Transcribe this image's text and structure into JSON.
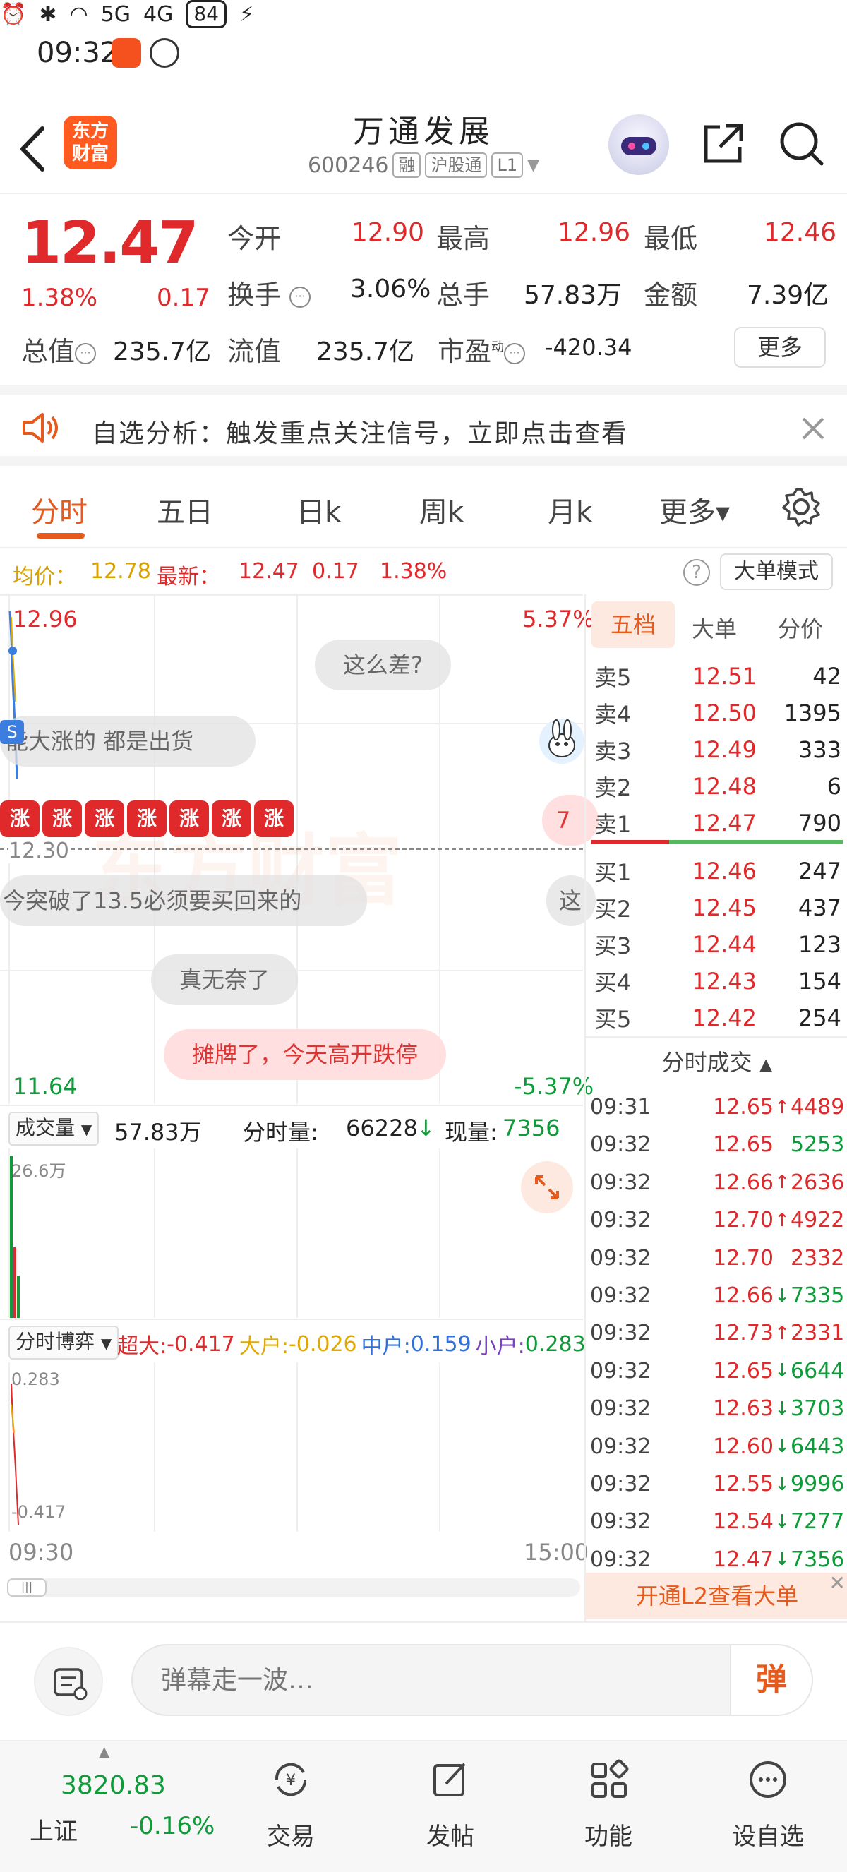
{
  "status": {
    "time": "09:32",
    "network_5g": "5G",
    "network_4g": "4G",
    "battery": "84"
  },
  "header": {
    "back_label": "",
    "logo_text_line1": "东方",
    "logo_text_line2": "财富",
    "stock_name": "万通发展",
    "stock_code": "600246",
    "tags": [
      "融",
      "沪股通",
      "L1"
    ]
  },
  "quote": {
    "price": "12.47",
    "change_pct": "1.38%",
    "change": "0.17",
    "open_label": "今开",
    "open": "12.90",
    "high_label": "最高",
    "high": "12.96",
    "low_label": "最低",
    "low": "12.46",
    "turnover_label": "换手",
    "turnover": "3.06%",
    "volume_label": "总手",
    "volume": "57.83万",
    "amount_label": "金额",
    "amount": "7.39亿",
    "mcap_label": "总值",
    "mcap": "235.7亿",
    "float_label": "流值",
    "float_val": "235.7亿",
    "pe_label": "市盈",
    "pe_sup": "动",
    "pe": "-420.34",
    "more_label": "更多"
  },
  "banner": {
    "text": "自选分析：触发重点关注信号，立即点击查看"
  },
  "tabs": [
    {
      "label": "分时"
    },
    {
      "label": "五日"
    },
    {
      "label": "日k"
    },
    {
      "label": "周k"
    },
    {
      "label": "月k"
    },
    {
      "label": "更多▾"
    }
  ],
  "avg": {
    "avg_label": "均价：",
    "avg_val": "12.78",
    "latest_label": "最新：",
    "latest_val": "12.47",
    "chg": "0.17",
    "chg_pct": "1.38%",
    "bigorder_label": "大单模式"
  },
  "chart": {
    "top_price": "12.96",
    "top_pct": "5.37%",
    "bottom_price": "11.64",
    "bottom_pct": "-5.37%",
    "mid_time": "12.30",
    "watermark": "东方财富",
    "danmu": [
      "这么差?",
      "能大涨的 都是出货",
      "今突破了13.5必须要买回来的",
      "真无奈了",
      "摊牌了，今天高开跌停"
    ],
    "zhang_char": "涨",
    "zhang_count": 7,
    "s_badge": "S",
    "pink_right_a": "7",
    "gray_right_b": "这"
  },
  "volume": {
    "dd_label": "成交量",
    "total": "57.83万",
    "minute_label": "分时量:",
    "minute": "66228",
    "current_label": "现量:",
    "current": "7356",
    "axis_max": "26.6万"
  },
  "game": {
    "dd_label": "分时博弈",
    "super_label": "超大:",
    "super_val": "-0.417",
    "big_label": "大户:",
    "big_val": "-0.026",
    "mid_label": "中户:",
    "mid_val": "0.159",
    "small_label": "小户:",
    "small_val": "0.283",
    "axis_top": "0.283",
    "axis_bottom": "-0.417",
    "start_time": "09:30",
    "end_time": "15:00"
  },
  "orderbook": {
    "tabs": [
      "五档",
      "大单",
      "分价"
    ],
    "asks": [
      {
        "label": "卖5",
        "price": "12.51",
        "vol": "42"
      },
      {
        "label": "卖4",
        "price": "12.50",
        "vol": "1395"
      },
      {
        "label": "卖3",
        "price": "12.49",
        "vol": "333"
      },
      {
        "label": "卖2",
        "price": "12.48",
        "vol": "6"
      },
      {
        "label": "卖1",
        "price": "12.47",
        "vol": "790"
      }
    ],
    "bids": [
      {
        "label": "买1",
        "price": "12.46",
        "vol": "247"
      },
      {
        "label": "买2",
        "price": "12.45",
        "vol": "437"
      },
      {
        "label": "买3",
        "price": "12.44",
        "vol": "123"
      },
      {
        "label": "买4",
        "price": "12.43",
        "vol": "154"
      },
      {
        "label": "买5",
        "price": "12.42",
        "vol": "254"
      }
    ],
    "ticks_title": "分时成交",
    "ticks": [
      {
        "t": "09:31",
        "p": "12.65",
        "dir": "up",
        "v": "4489",
        "vc": "red"
      },
      {
        "t": "09:32",
        "p": "12.65",
        "dir": "",
        "v": "5253",
        "vc": "green"
      },
      {
        "t": "09:32",
        "p": "12.66",
        "dir": "up",
        "v": "2636",
        "vc": "red"
      },
      {
        "t": "09:32",
        "p": "12.70",
        "dir": "up",
        "v": "4922",
        "vc": "red"
      },
      {
        "t": "09:32",
        "p": "12.70",
        "dir": "",
        "v": "2332",
        "vc": "red"
      },
      {
        "t": "09:32",
        "p": "12.66",
        "dir": "down",
        "v": "7335",
        "vc": "green"
      },
      {
        "t": "09:32",
        "p": "12.73",
        "dir": "up",
        "v": "2331",
        "vc": "red"
      },
      {
        "t": "09:32",
        "p": "12.65",
        "dir": "down",
        "v": "6644",
        "vc": "green"
      },
      {
        "t": "09:32",
        "p": "12.63",
        "dir": "down",
        "v": "3703",
        "vc": "green"
      },
      {
        "t": "09:32",
        "p": "12.60",
        "dir": "down",
        "v": "6443",
        "vc": "green"
      },
      {
        "t": "09:32",
        "p": "12.55",
        "dir": "down",
        "v": "9996",
        "vc": "green"
      },
      {
        "t": "09:32",
        "p": "12.54",
        "dir": "down",
        "v": "7277",
        "vc": "green"
      },
      {
        "t": "09:32",
        "p": "12.47",
        "dir": "down",
        "v": "7356",
        "vc": "green"
      }
    ],
    "l2_label": "开通L2查看大单"
  },
  "comment": {
    "placeholder": "弹幕走一波…",
    "send_label": "弹"
  },
  "bottomnav": {
    "index_value": "3820.83",
    "index_name": "上证",
    "index_change": "-0.16%",
    "items": [
      {
        "label": "交易"
      },
      {
        "label": "发帖"
      },
      {
        "label": "功能"
      },
      {
        "label": "设自选"
      }
    ]
  },
  "colors": {
    "up": "#e0292b",
    "down": "#0f9b3a",
    "accent": "#e65a1e"
  }
}
